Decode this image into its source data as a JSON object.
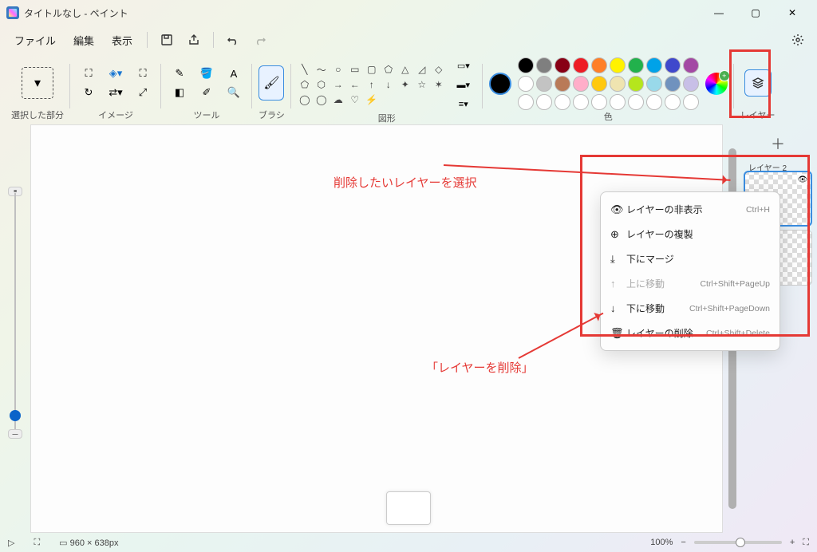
{
  "title": "タイトルなし - ペイント",
  "menu": {
    "file": "ファイル",
    "edit": "編集",
    "view": "表示"
  },
  "ribbon": {
    "select": "選択した部分",
    "image": "イメージ",
    "tool": "ツール",
    "brush": "ブラシ",
    "shape": "図形",
    "color": "色",
    "layer": "レイヤー"
  },
  "palette_row1": [
    "#000000",
    "#7f7f7f",
    "#880015",
    "#ed1c24",
    "#ff7f27",
    "#fff200",
    "#22b14c",
    "#00a2e8",
    "#3f48cc",
    "#a349a4"
  ],
  "palette_row2": [
    "#ffffff",
    "#c3c3c3",
    "#b97a57",
    "#ffaec9",
    "#ffc90e",
    "#efe4b0",
    "#b5e61d",
    "#99d9ea",
    "#7092be",
    "#c8bfe7"
  ],
  "palette_row3": [
    "#ffffff",
    "#ffffff",
    "#ffffff",
    "#ffffff",
    "#ffffff",
    "#ffffff",
    "#ffffff",
    "#ffffff",
    "#ffffff",
    "#ffffff"
  ],
  "layers": {
    "add": "＋",
    "layer2": "レイヤー 2"
  },
  "ctx": {
    "hide": {
      "label": "レイヤーの非表示",
      "short": "Ctrl+H"
    },
    "dup": {
      "label": "レイヤーの複製",
      "short": ""
    },
    "merge": {
      "label": "下にマージ",
      "short": ""
    },
    "up": {
      "label": "上に移動",
      "short": "Ctrl+Shift+PageUp"
    },
    "down": {
      "label": "下に移動",
      "short": "Ctrl+Shift+PageDown"
    },
    "delete": {
      "label": "レイヤーの削除",
      "short": "Ctrl+Shift+Delete"
    }
  },
  "status": {
    "dims": "960 × 638px",
    "zoom": "100%"
  },
  "anno": {
    "select_layer": "削除したいレイヤーを選択",
    "delete_layer": "「レイヤーを削除」"
  }
}
